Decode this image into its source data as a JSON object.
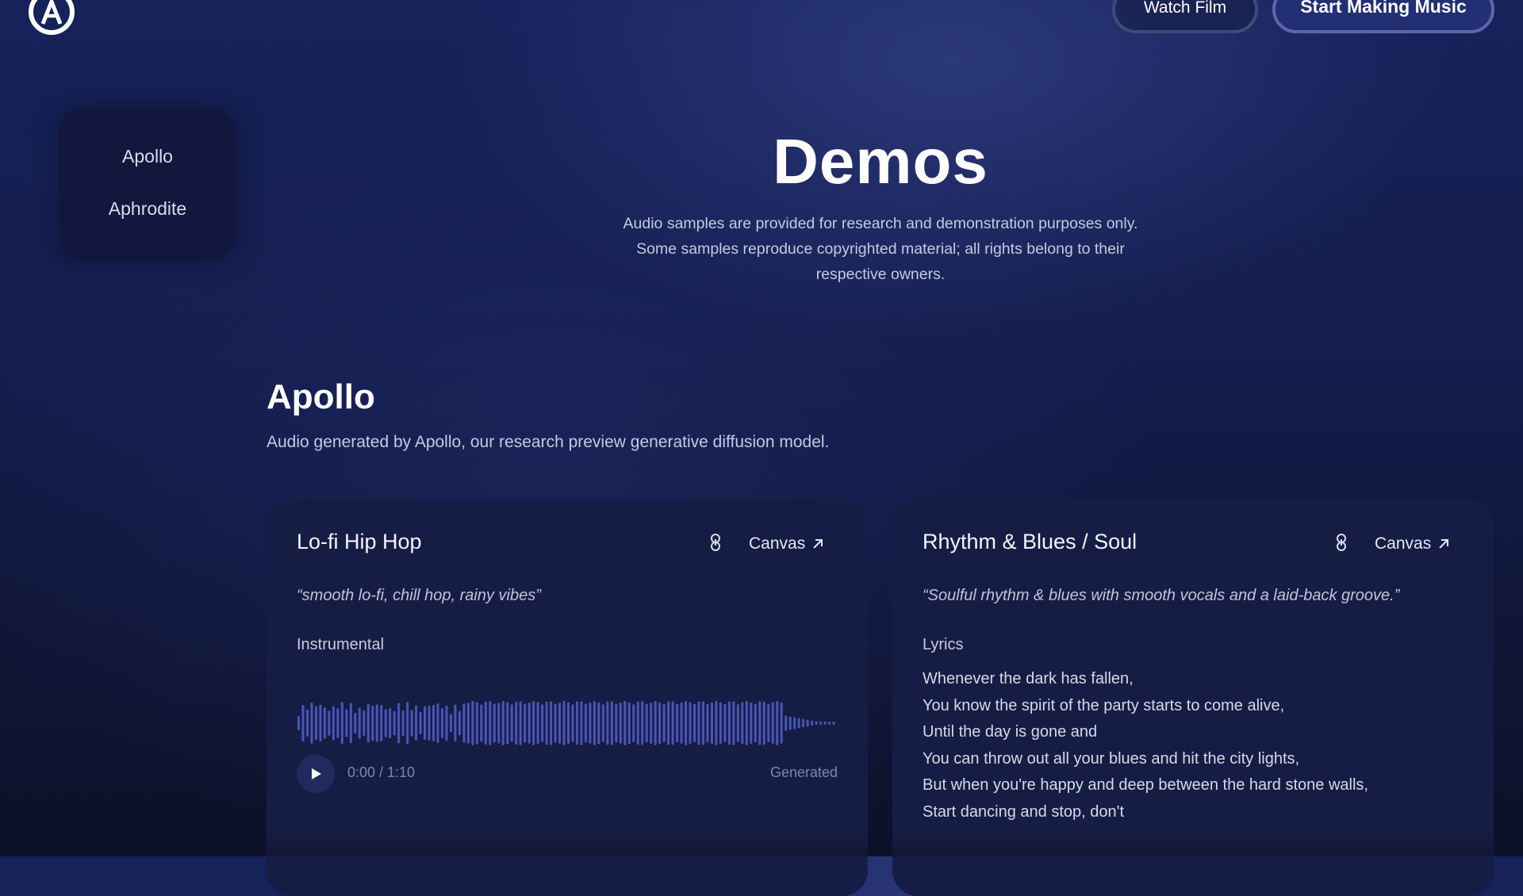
{
  "header": {
    "logo_icon": "apollo-logo-icon",
    "watch_film_label": "Watch Film",
    "start_label": "Start Making Music"
  },
  "sidebar": {
    "items": [
      {
        "label": "Apollo"
      },
      {
        "label": "Aphrodite"
      }
    ]
  },
  "hero": {
    "title": "Demos",
    "subtitle_lines": [
      "Audio samples are provided for research and demonstration purposes only.",
      "Some samples reproduce copyrighted material; all rights belong to their",
      "respective owners."
    ]
  },
  "section": {
    "title": "Apollo",
    "description": "Audio generated by Apollo, our research preview generative diffusion model."
  },
  "cards": [
    {
      "title": "Lo-fi Hip Hop",
      "link_icon": "link-icon",
      "canvas_label": "Canvas",
      "prompt": "“smooth lo-fi, chill hop, rainy vibes”",
      "label": "Instrumental",
      "time": "0:00 / 1:10",
      "status": "Generated"
    },
    {
      "title": "Rhythm & Blues / Soul",
      "link_icon": "link-icon",
      "canvas_label": "Canvas",
      "prompt": "“Soulful rhythm & blues with smooth vocals and a laid-back groove.”",
      "label": "Lyrics",
      "lyrics": [
        "Whenever the dark has fallen,",
        "You know the spirit of the party starts to come alive,",
        "Until the day is gone and",
        "You can throw out all your blues and hit the city lights,",
        "But when you're happy and deep between the hard stone walls,",
        "Start dancing and stop, don't"
      ]
    }
  ],
  "colors": {
    "accent": "#222f72",
    "waveform": "#4a55b8",
    "card": "#161d45"
  }
}
